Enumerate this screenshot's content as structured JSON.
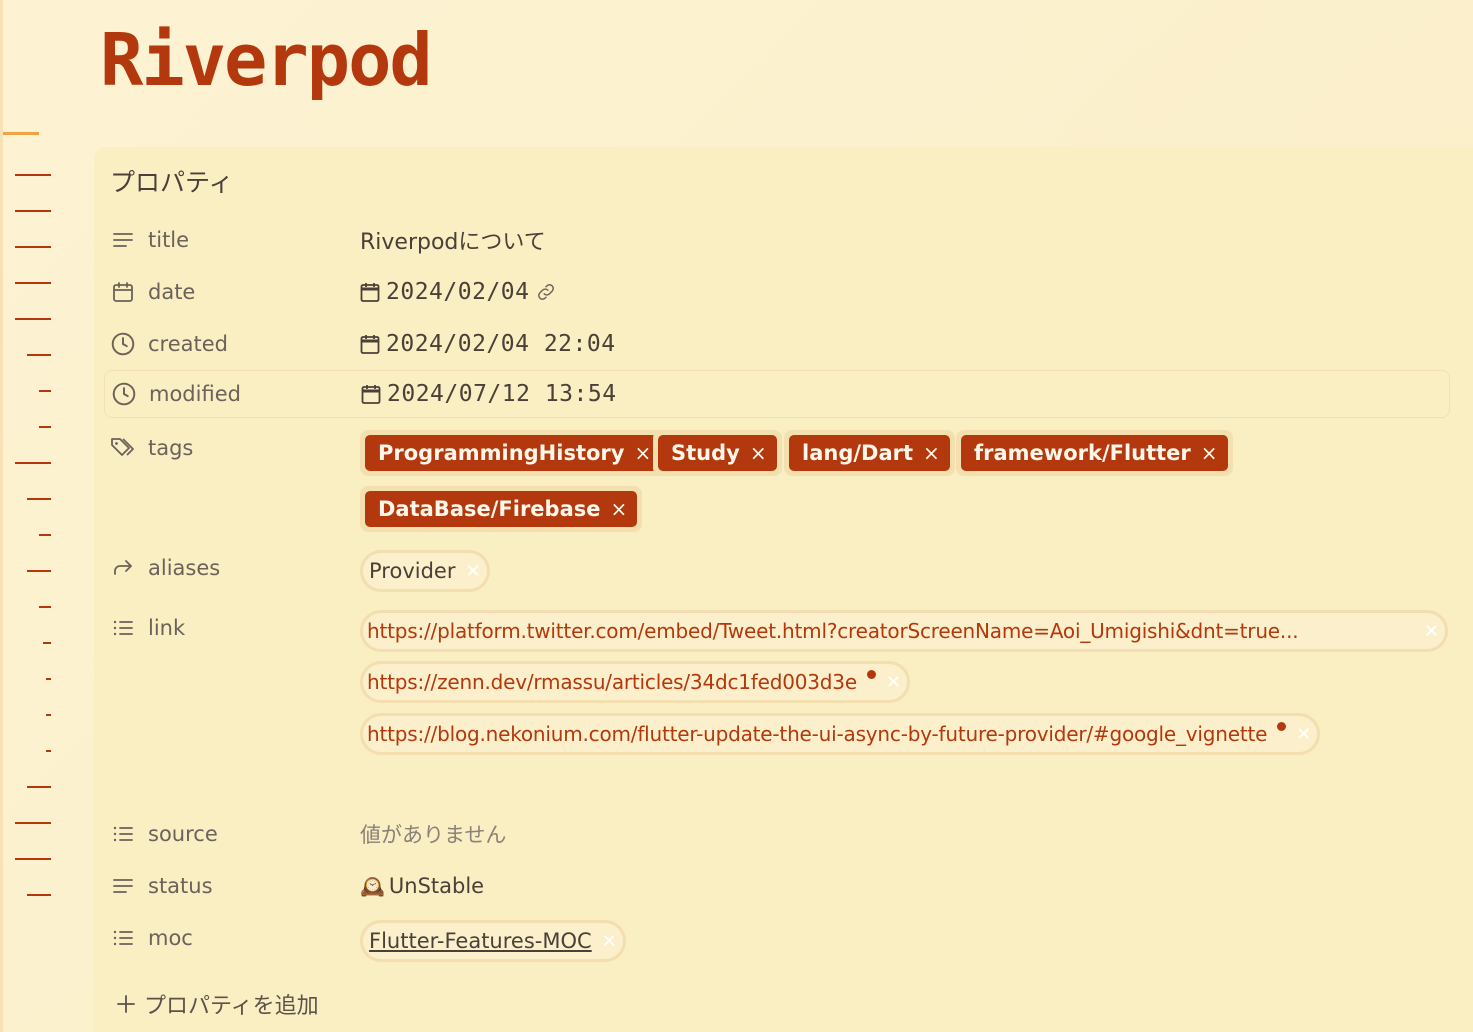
{
  "page": {
    "title": "Riverpod"
  },
  "properties": {
    "heading": "プロパティ",
    "title": {
      "key": "title",
      "value": "Riverpodについて"
    },
    "date": {
      "key": "date",
      "value": "2024/02/04"
    },
    "created": {
      "key": "created",
      "value": "2024/02/04 22:04"
    },
    "modified": {
      "key": "modified",
      "value": "2024/07/12 13:54"
    },
    "tags": {
      "key": "tags",
      "items": [
        "ProgrammingHistory",
        "Study",
        "lang/Dart",
        "framework/Flutter",
        "DataBase/Firebase"
      ],
      "remove_glyph": "×"
    },
    "aliases": {
      "key": "aliases",
      "items": [
        "Provider"
      ]
    },
    "link": {
      "key": "link",
      "items": [
        "https://platform.twitter.com/embed/Tweet.html?creatorScreenName=Aoi_Umigishi&dnt=true...",
        "https://zenn.dev/rmassu/articles/34dc1fed003d3e",
        "https://blog.nekonium.com/flutter-update-the-ui-async-by-future-provider/#google_vignette"
      ]
    },
    "source": {
      "key": "source",
      "value": "値がありません"
    },
    "status": {
      "key": "status",
      "emoji": "🕰️",
      "value": "UnStable"
    },
    "moc": {
      "key": "moc",
      "items": [
        "Flutter-Features-MOC"
      ]
    },
    "add_label": "プロパティを追加"
  },
  "colors": {
    "accent": "#b3380d",
    "background": "#fbf0cb",
    "pill_border": "#f3deb0",
    "outline_active": "#eea443"
  }
}
